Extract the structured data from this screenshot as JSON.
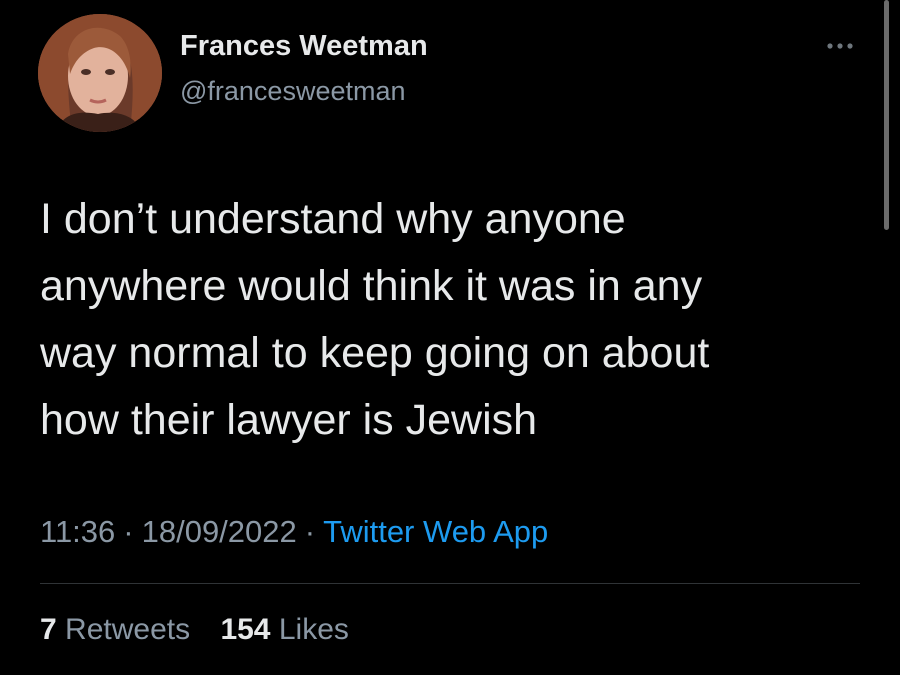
{
  "tweet": {
    "author": {
      "display_name": "Frances Weetman",
      "handle": "@francesweetman"
    },
    "text_lines": [
      "I don’t understand why anyone",
      "anywhere would think it was in any",
      "way normal to keep going on about",
      "how their lawyer is Jewish"
    ],
    "time": "11:36",
    "date": "18/09/2022",
    "separator": "·",
    "source": "Twitter Web App",
    "stats": {
      "retweets_count": "7",
      "retweets_label": "Retweets",
      "likes_count": "154",
      "likes_label": "Likes"
    }
  },
  "colors": {
    "background": "#000000",
    "text_primary": "#e7e9ea",
    "text_secondary": "#8b98a5",
    "link": "#1d9bf0",
    "divider": "#2f3336"
  },
  "icons": {
    "more": "more-horizontal-icon"
  }
}
